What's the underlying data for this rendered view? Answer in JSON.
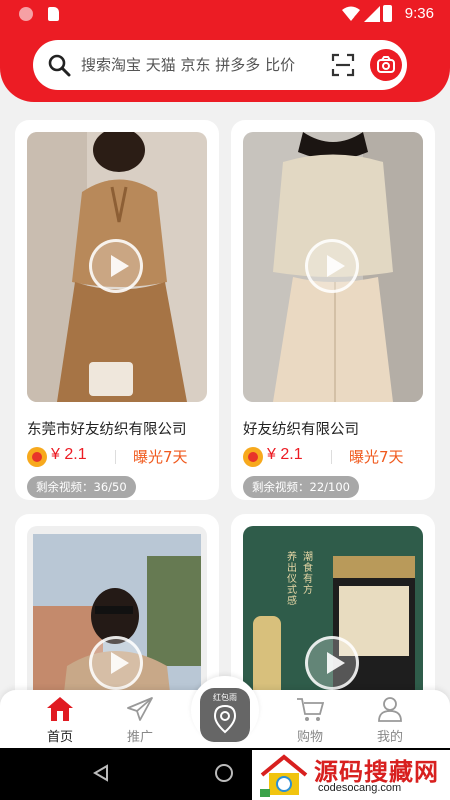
{
  "status_bar": {
    "time": "9:36"
  },
  "search": {
    "placeholder": "搜索淘宝 天猫 京东 拼多多 比价"
  },
  "products": [
    {
      "company": "东莞市好友纺织有限公司",
      "price": "¥ 2.1",
      "exposure": "曝光7天",
      "remaining": "剩余视频：36/50"
    },
    {
      "company": "好友纺织有限公司",
      "price": "¥ 2.1",
      "exposure": "曝光7天",
      "remaining": "剩余视频：22/100"
    },
    {
      "company": "",
      "price": "",
      "exposure": "",
      "remaining": ""
    },
    {
      "company": "",
      "price": "",
      "exposure": "",
      "remaining": ""
    }
  ],
  "promo_text": [
    "潮食有方",
    "养出仪式感"
  ],
  "tabbar": {
    "home": "首页",
    "promote": "推广",
    "center": "红包雨",
    "cart": "购物",
    "me": "我的"
  },
  "watermark": {
    "title": "源码搜藏网",
    "url": "codesocang.com"
  },
  "colors": {
    "accent": "#ec1c24",
    "exposure": "#f05a1e",
    "badge_bg": "#a8a8a8"
  }
}
